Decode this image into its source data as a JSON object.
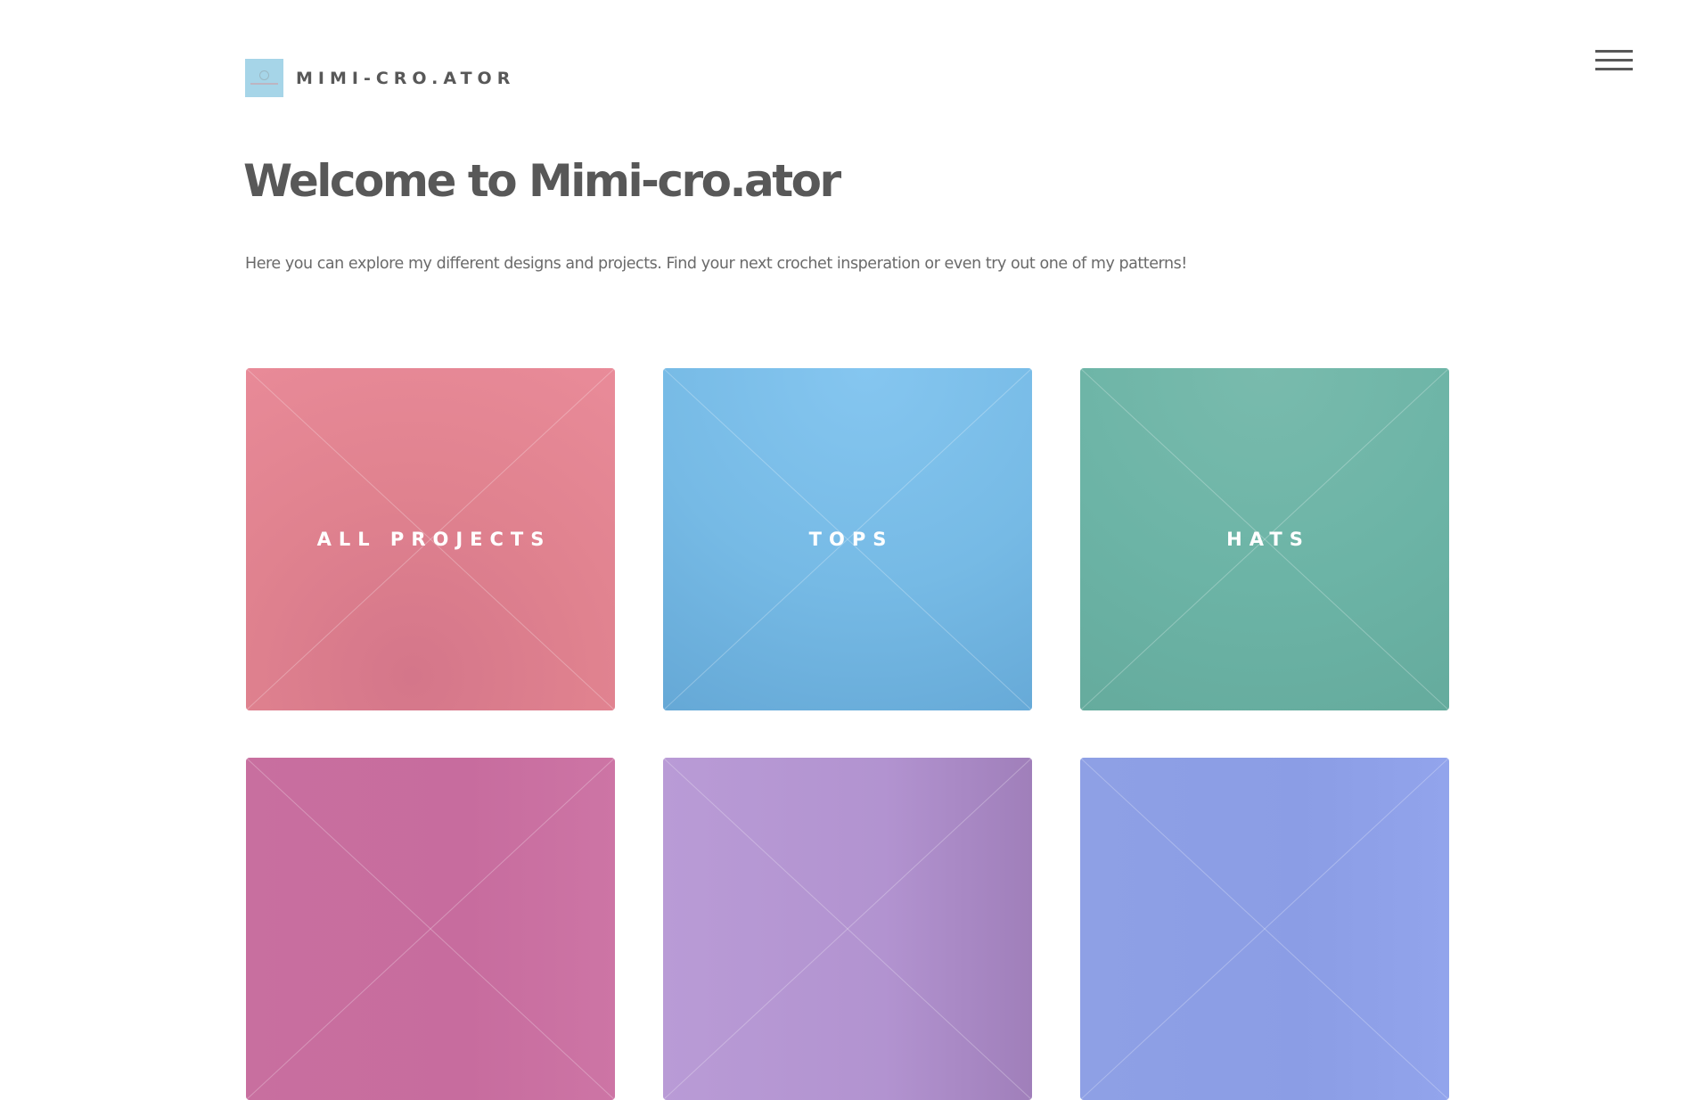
{
  "header": {
    "logo_text": "MIMI-CRO.ATOR",
    "menu_icon": "hamburger-menu-icon"
  },
  "main": {
    "title": "Welcome to Mimi-cro.ator",
    "intro": "Here you can explore my different designs and projects. Find your next crochet insperation or even try out one of my patterns!"
  },
  "tiles": [
    {
      "label": "All Projects",
      "color": "#e0828f"
    },
    {
      "label": "Tops",
      "color": "#76bae5"
    },
    {
      "label": "Hats",
      "color": "#6cb4a6"
    },
    {
      "label": "",
      "color": "#c76c9e"
    },
    {
      "label": "",
      "color": "#b293d0"
    },
    {
      "label": "",
      "color": "#8b9de5"
    }
  ]
}
